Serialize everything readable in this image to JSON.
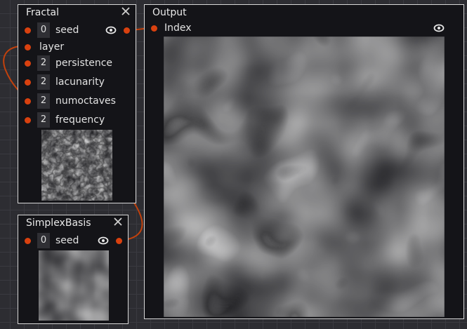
{
  "nodes": {
    "fractal": {
      "title": "Fractal",
      "inputs": [
        {
          "value": "0",
          "label": "seed"
        },
        {
          "value": "",
          "label": "layer"
        },
        {
          "value": "2",
          "label": "persistence"
        },
        {
          "value": "2",
          "label": "lacunarity"
        },
        {
          "value": "2",
          "label": "numoctaves"
        },
        {
          "value": "2",
          "label": "frequency"
        }
      ]
    },
    "simplex": {
      "title": "SimplexBasis",
      "inputs": [
        {
          "value": "0",
          "label": "seed"
        }
      ]
    },
    "output": {
      "title": "Output",
      "inputs": [
        {
          "label": "Index"
        }
      ]
    }
  },
  "colors": {
    "port": "#d9410f",
    "wire": "#c2410c",
    "node_bg": "#141418",
    "node_border": "#d8d8d8",
    "canvas_bg": "#2d2d32",
    "grid": "#3a3a40"
  },
  "icons": [
    "close-icon",
    "eye-icon"
  ]
}
